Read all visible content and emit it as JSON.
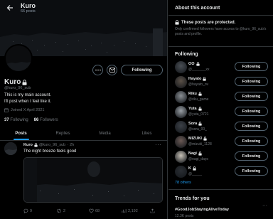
{
  "header": {
    "name": "Kuro",
    "posts": "66 posts"
  },
  "profile": {
    "name": "Kuro",
    "handle": "@kuro_96_sub",
    "bio_line1": "This is my main account.",
    "bio_line2": "I'll post when I feel like it.",
    "joined": "Joined X April 2021",
    "following_count": "37",
    "following_label": "Following",
    "followers_count": "86",
    "followers_label": "Followers",
    "follow_button": "Following"
  },
  "tabs": [
    "Posts",
    "Replies",
    "Media",
    "Likes"
  ],
  "post": {
    "name": "Kuro",
    "handle": "@kuro_96_sub",
    "time": "2h",
    "text": "The night breeze feels good",
    "actions": {
      "replies": "9",
      "reposts": "2",
      "likes": "68",
      "views": "2,192"
    }
  },
  "sidebar": {
    "about_title": "About this account",
    "protected_title": "These posts are protected.",
    "protected_desc": "Only confirmed followers have access to @kuro_96_sub's posts and profile.",
    "following_title": "Following",
    "following": [
      {
        "name": "OO",
        "handle": "@_______xx",
        "button": "Following",
        "color": "#4a4f55"
      },
      {
        "name": "Hayato",
        "handle": "@hayato_ov",
        "button": "Following",
        "color": "#5b5148"
      },
      {
        "name": "Riku",
        "handle": "@riku_game",
        "button": "Following",
        "color": "#8a8f94"
      },
      {
        "name": "Yuta",
        "handle": "@yuta_0721",
        "button": "Following",
        "color": "#9aa0a6"
      },
      {
        "name": "Sora",
        "handle": "@sora_00_",
        "button": "Following",
        "color": "#3c4148"
      },
      {
        "name": "MIZUKI",
        "handle": "@mizuki_1128",
        "button": "Following",
        "color": "#6b5a55"
      },
      {
        "name": "Nagi",
        "handle": "@nagi_days",
        "button": "Following",
        "color": "#c9c3b8"
      },
      {
        "name": "K",
        "handle": "@_____",
        "button": "Following",
        "color": "#2a2e33"
      }
    ],
    "others": "78 others",
    "trends_title": "Trends for you",
    "trend_tag": "#GoodJobStayingAliveToday",
    "trend_count": "12.3K posts"
  }
}
